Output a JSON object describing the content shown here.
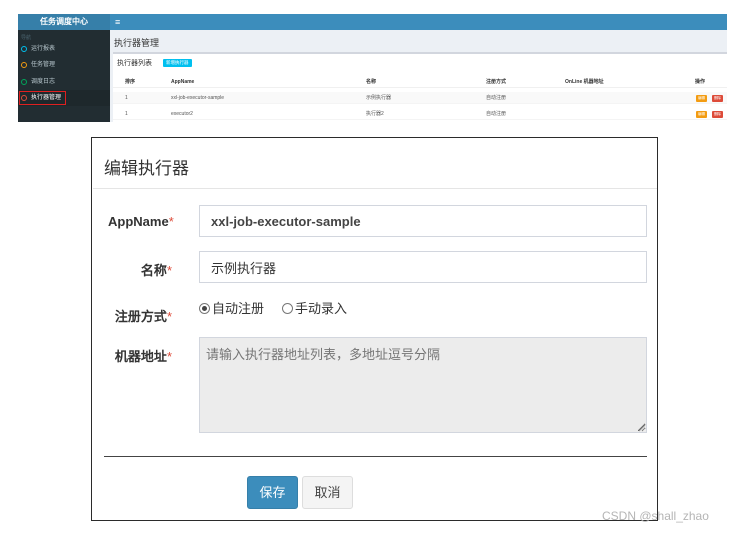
{
  "app": {
    "brand": "任务调度中心",
    "menu_icon": "≡",
    "sidebar": {
      "section": "导航",
      "items": [
        {
          "label": "运行报表"
        },
        {
          "label": "任务管理"
        },
        {
          "label": "调度日志"
        },
        {
          "label": "执行器管理",
          "active": true
        }
      ]
    },
    "page_title": "执行器管理",
    "box_title": "执行器列表",
    "add_button": "新增执行器",
    "table": {
      "headers": [
        "排序",
        "AppName",
        "名称",
        "注册方式",
        "OnLine 机器地址",
        "操作"
      ],
      "rows": [
        {
          "order": "1",
          "appname": "xxl-job-executor-sample",
          "name": "示例执行器",
          "reg": "自动注册",
          "online": ""
        },
        {
          "order": "1",
          "appname": "executor2",
          "name": "执行器2",
          "reg": "自动注册",
          "online": ""
        }
      ],
      "edit_label": "编辑",
      "delete_label": "删除"
    }
  },
  "modal": {
    "title": "编辑执行器",
    "fields": {
      "appname": {
        "label": "AppName",
        "value": "xxl-job-executor-sample"
      },
      "name": {
        "label": "名称",
        "value": "示例执行器"
      },
      "reg_type": {
        "label": "注册方式",
        "options": [
          "自动注册",
          "手动录入"
        ],
        "selected": "自动注册"
      },
      "address": {
        "label": "机器地址",
        "placeholder": "请输入执行器地址列表，多地址逗号分隔"
      }
    },
    "required_mark": "*",
    "save": "保存",
    "cancel": "取消"
  },
  "watermark": "CSDN @shall_zhao",
  "colors": {
    "primary": "#3c8dbc",
    "danger": "#dd4b39",
    "warning": "#f39c12",
    "info": "#00c0ef",
    "sidebar": "#222d32"
  }
}
